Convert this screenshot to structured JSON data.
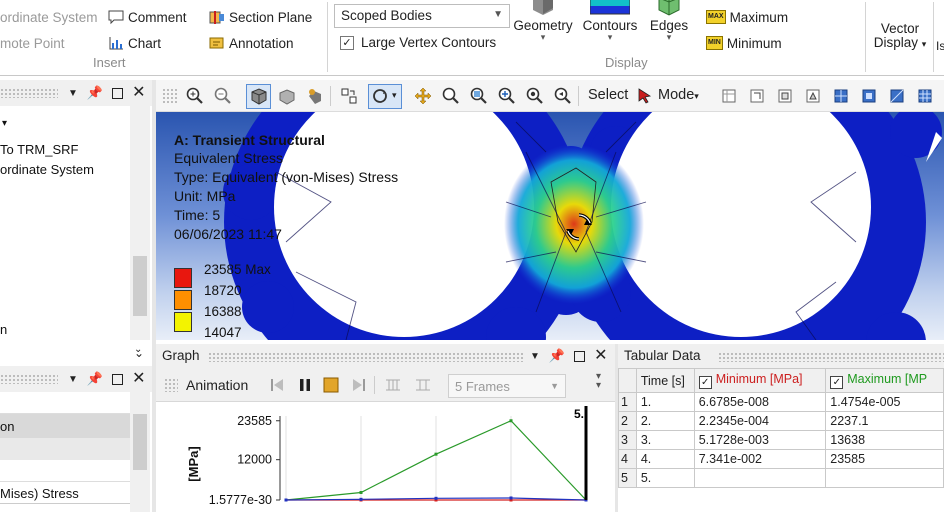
{
  "ribbon": {
    "insert": {
      "coordinate_system": "ordinate System",
      "remote_point": "mote Point",
      "comment": "Comment",
      "chart": "Chart",
      "section_plane": "Section Plane",
      "annotation": "Annotation",
      "group_label": "Insert"
    },
    "display": {
      "scope_dropdown": "Scoped Bodies",
      "large_vertex_contours": "Large Vertex Contours",
      "large_vertex_checked": true,
      "geometry": "Geometry",
      "contours": "Contours",
      "edges": "Edges",
      "maximum": "Maximum",
      "minimum": "Minimum",
      "max_badge": "MAX",
      "min_badge": "MIN",
      "group_label": "Display"
    },
    "vector_display_line1": "Vector",
    "vector_display_line2": "Display",
    "cut_item": "Is"
  },
  "outline_panel": {
    "item1": "To  TRM_SRF",
    "item2": "ordinate System",
    "item3": "n"
  },
  "details_panel": {
    "row1": "on",
    "row2": "Mises) Stress"
  },
  "graphics_toolbar": {
    "select_label": "Select",
    "mode_label": "Mode"
  },
  "viewport": {
    "title": "A: Transient Structural",
    "line_result": "Equivalent Stress",
    "line_type": "Type: Equivalent (von-Mises) Stress",
    "line_unit": "Unit: MPa",
    "line_time": "Time: 5",
    "line_date": "06/06/2023 11:47",
    "legend_max_label": "23585 Max",
    "legend_values": [
      "18720",
      "16388",
      "14047"
    ],
    "legend_colors": [
      "#e8170f",
      "#ff8f00",
      "#f3f300"
    ]
  },
  "graph_panel": {
    "title": "Graph",
    "animation_label": "Animation",
    "frames_value": "5 Frames"
  },
  "chart_data": {
    "type": "line",
    "title": "",
    "xlabel": "",
    "ylabel": "[MPa]",
    "x": [
      1,
      2,
      3,
      4,
      5
    ],
    "ylim": [
      1.5777e-30,
      25000
    ],
    "ytick_labels": [
      "23585",
      "12000",
      "1.5777e-30"
    ],
    "ytick_values": [
      23585,
      12000,
      0
    ],
    "current_frame_label": "5.",
    "series": [
      {
        "values": [
          1.4754e-05,
          2237.1,
          13638,
          23585,
          0
        ],
        "color": "#2a9a2a"
      },
      {
        "values": [
          6.6785e-08,
          0.00022345,
          0.0051728,
          0.07341,
          0
        ],
        "color": "#d42020"
      },
      {
        "values": [
          0,
          200,
          500,
          600,
          0
        ],
        "color": "#2233c0"
      }
    ]
  },
  "tabular": {
    "title": "Tabular Data",
    "headers": [
      "Time [s]",
      "Minimum [MPa]",
      "Maximum [MP"
    ],
    "header_colors": {
      "min": "#cc1f1f",
      "max": "#1f9a1f"
    },
    "rows": [
      {
        "n": "1",
        "time": "1.",
        "min": "6.6785e-008",
        "max": "1.4754e-005"
      },
      {
        "n": "2",
        "time": "2.",
        "min": "2.2345e-004",
        "max": "2237.1"
      },
      {
        "n": "3",
        "time": "3.",
        "min": "5.1728e-003",
        "max": "13638"
      },
      {
        "n": "4",
        "time": "4.",
        "min": "7.341e-002",
        "max": "23585"
      },
      {
        "n": "5",
        "time": "5.",
        "min": "",
        "max": ""
      }
    ]
  }
}
